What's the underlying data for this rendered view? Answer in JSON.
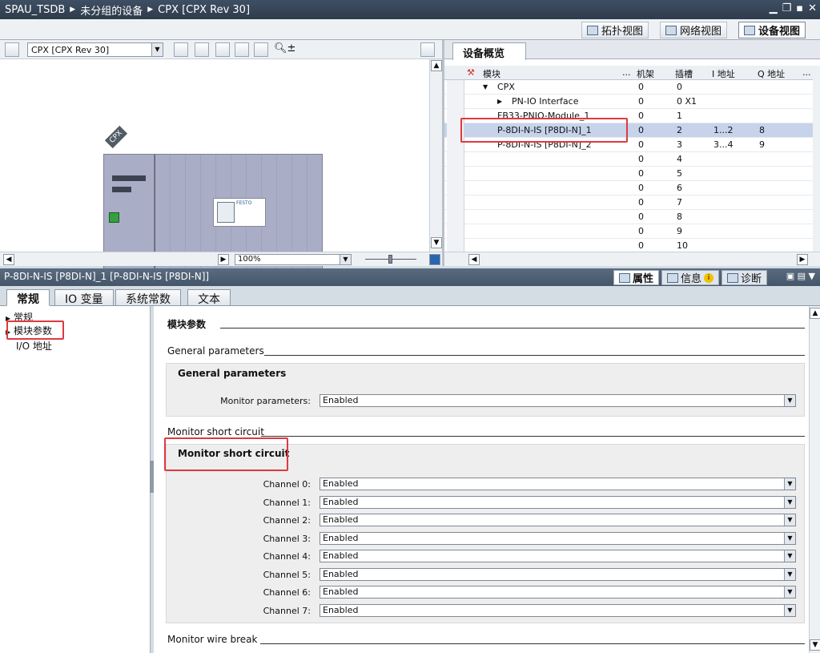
{
  "title_bar": {
    "crumbs": [
      "SPAU_TSDB",
      "未分组的设备",
      "CPX [CPX Rev 30]"
    ]
  },
  "view_tabs": [
    "拓扑视图",
    "网络视图",
    "设备视图"
  ],
  "device_selector": "CPX [CPX Rev 30]",
  "device_graphic": {
    "tag": "CPX",
    "brand": "FESTO"
  },
  "zoom": "100%",
  "overview": {
    "tab": "设备概览",
    "columns": [
      "模块",
      "...",
      "机架",
      "插槽",
      "I 地址",
      "Q 地址",
      "..."
    ],
    "rows": [
      {
        "module": "CPX",
        "rack": "0",
        "slot": "0",
        "i": "",
        "q": "",
        "level": 0,
        "expand": "down"
      },
      {
        "module": "PN-IO Interface",
        "rack": "0",
        "slot": "0 X1",
        "i": "",
        "q": "",
        "level": 1,
        "expand": "right"
      },
      {
        "module": "FB33-PNIO-Module_1",
        "rack": "0",
        "slot": "1",
        "i": "",
        "q": "",
        "level": 0,
        "expand": ""
      },
      {
        "module": "P-8DI-N-IS [P8DI-N]_1",
        "rack": "0",
        "slot": "2",
        "i": "1...2",
        "q": "8",
        "level": 0,
        "expand": "",
        "selected": true
      },
      {
        "module": "P-8DI-N-IS [P8DI-N]_2",
        "rack": "0",
        "slot": "3",
        "i": "3...4",
        "q": "9",
        "level": 0,
        "expand": ""
      },
      {
        "module": "",
        "rack": "0",
        "slot": "4",
        "i": "",
        "q": ""
      },
      {
        "module": "",
        "rack": "0",
        "slot": "5",
        "i": "",
        "q": ""
      },
      {
        "module": "",
        "rack": "0",
        "slot": "6",
        "i": "",
        "q": ""
      },
      {
        "module": "",
        "rack": "0",
        "slot": "7",
        "i": "",
        "q": ""
      },
      {
        "module": "",
        "rack": "0",
        "slot": "8",
        "i": "",
        "q": ""
      },
      {
        "module": "",
        "rack": "0",
        "slot": "9",
        "i": "",
        "q": ""
      },
      {
        "module": "",
        "rack": "0",
        "slot": "10",
        "i": "",
        "q": ""
      }
    ]
  },
  "properties": {
    "header": "P-8DI-N-IS [P8DI-N]_1 [P-8DI-N-IS [P8DI-N]]",
    "tabs": [
      "属性",
      "信息",
      "诊断"
    ],
    "subtabs": [
      "常规",
      "IO 变量",
      "系统常数",
      "文本"
    ],
    "nav": [
      "常规",
      "模块参数",
      "I/O 地址"
    ]
  },
  "module_params": {
    "title": "模块参数",
    "general_section": "General parameters",
    "general_panel_title": "General parameters",
    "monitor_parameters_label": "Monitor parameters:",
    "monitor_parameters_value": "Enabled",
    "short_section": "Monitor short circuit",
    "short_panel_title": "Monitor short circuit",
    "channels": [
      {
        "label": "Channel 0:",
        "value": "Enabled"
      },
      {
        "label": "Channel 1:",
        "value": "Enabled"
      },
      {
        "label": "Channel 2:",
        "value": "Enabled"
      },
      {
        "label": "Channel 3:",
        "value": "Enabled"
      },
      {
        "label": "Channel 4:",
        "value": "Enabled"
      },
      {
        "label": "Channel 5:",
        "value": "Enabled"
      },
      {
        "label": "Channel 6:",
        "value": "Enabled"
      },
      {
        "label": "Channel 7:",
        "value": "Enabled"
      }
    ],
    "wire_break_section": "Monitor wire break"
  },
  "colors": {
    "highlight_box": "#e0393e",
    "selected_row": "#c6d3ea",
    "port_green": "#34a040"
  }
}
